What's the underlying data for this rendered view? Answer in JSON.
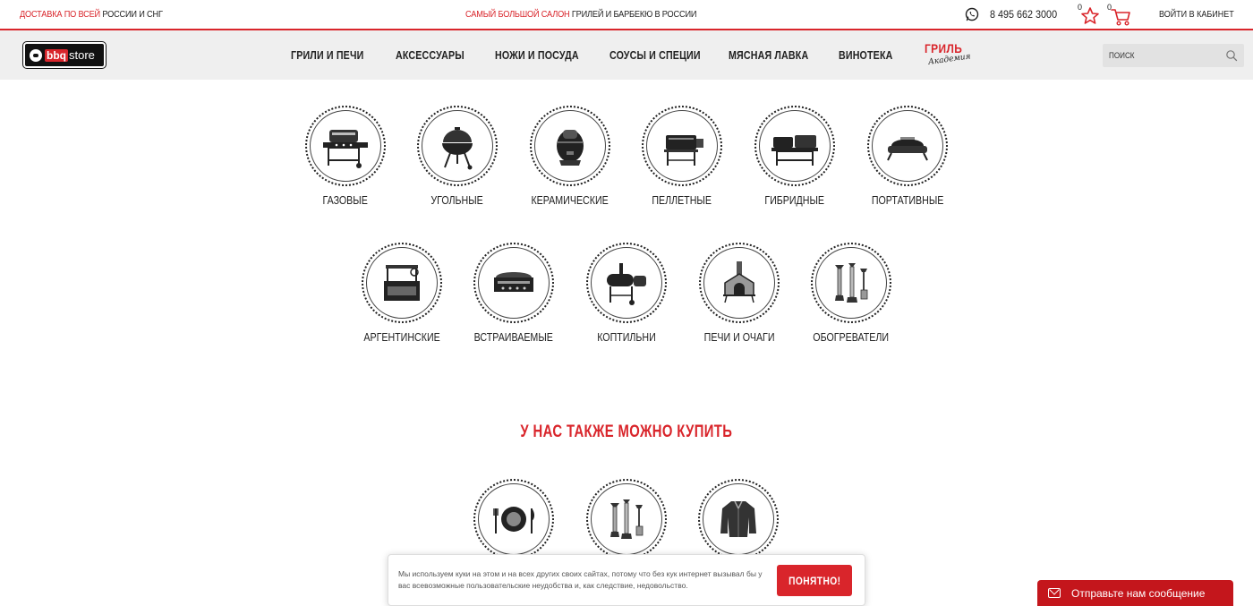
{
  "topbar": {
    "delivery_red": "ДОСТАВКА ПО ВСЕЙ",
    "delivery_dark": "РОССИИ И СНГ",
    "salon_red": "САМЫЙ БОЛЬШОЙ САЛОН",
    "salon_dark": "ГРИЛЕЙ И БАРБЕКЮ В РОССИИ",
    "phone": "8 495 662 3000",
    "favorites_count": "0",
    "cart_count": "0",
    "login": "ВОЙТИ В КАБИНЕТ"
  },
  "logo": {
    "part1": "bbq",
    "part2": "store"
  },
  "nav": {
    "items": [
      "ГРИЛИ И ПЕЧИ",
      "АКСЕССУАРЫ",
      "НОЖИ И ПОСУДА",
      "СОУСЫ И СПЕЦИИ",
      "МЯСНАЯ ЛАВКА",
      "ВИНОТЕКА"
    ],
    "academy_title": "ГРИЛЬ",
    "academy_sub": "Академия"
  },
  "search": {
    "placeholder": "ПОИСК"
  },
  "categories_row1": [
    {
      "label": "ГАЗОВЫЕ",
      "icon": "gas-grill-icon"
    },
    {
      "label": "УГОЛЬНЫЕ",
      "icon": "charcoal-kettle-grill-icon"
    },
    {
      "label": "КЕРАМИЧЕСКИЕ",
      "icon": "ceramic-egg-grill-icon"
    },
    {
      "label": "ПЕЛЛЕТНЫЕ",
      "icon": "pellet-grill-icon"
    },
    {
      "label": "ГИБРИДНЫЕ",
      "icon": "hybrid-grill-icon"
    },
    {
      "label": "ПОРТАТИВНЫЕ",
      "icon": "portable-grill-icon"
    }
  ],
  "categories_row2": [
    {
      "label": "АРГЕНТИНСКИЕ",
      "icon": "argentine-grill-icon"
    },
    {
      "label": "ВСТРАИВАЕМЫЕ",
      "icon": "built-in-grill-icon"
    },
    {
      "label": "КОПТИЛЬНИ",
      "icon": "smoker-icon"
    },
    {
      "label": "ПЕЧИ И ОЧАГИ",
      "icon": "pizza-oven-icon"
    },
    {
      "label": "ОБОГРЕВАТЕЛИ",
      "icon": "patio-heater-icon"
    }
  ],
  "also_title": "У НАС ТАКЖЕ МОЖНО КУПИТЬ",
  "also_items": [
    {
      "icon": "tableware-icon"
    },
    {
      "icon": "patio-heater-icon"
    },
    {
      "icon": "jacket-icon"
    }
  ],
  "cookie": {
    "text": "Мы используем куки на этом и на всех других своих сайтах, потому что без кук интернет вызывал бы у вас всевозможные пользовательские неудобства и, как следствие, недовольство.",
    "button": "ПОНЯТНО!"
  },
  "chat": {
    "label": "Отправьте нам сообщение"
  },
  "colors": {
    "accent": "#d9252b",
    "navbar_bg": "#efefef",
    "chat_bg": "#c4161c"
  }
}
